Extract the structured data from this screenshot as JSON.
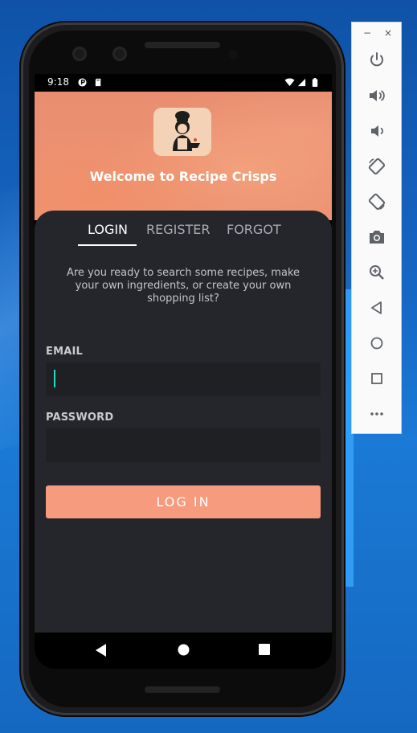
{
  "status_bar": {
    "time": "9:18"
  },
  "app": {
    "welcome_title": "Welcome to Recipe Crisps",
    "tabs": [
      {
        "label": "LOGIN",
        "active": true
      },
      {
        "label": "REGISTER",
        "active": false
      },
      {
        "label": "FORGOT",
        "active": false
      }
    ],
    "intro_text": "Are you ready to search some recipes, make your own ingredients, or create your own shopping list?",
    "email_label": "EMAIL",
    "email_value": "",
    "password_label": "PASSWORD",
    "password_value": "",
    "login_button_label": "LOG IN"
  },
  "colors": {
    "accent": "#f79b7e",
    "panel_bg": "#24262b",
    "field_bg": "#1e2024",
    "caret": "#2ad8c4"
  },
  "emulator_toolbar": {
    "window_controls": {
      "minimize": "−",
      "close": "×"
    },
    "buttons": [
      "power-icon",
      "volume-up-icon",
      "volume-down-icon",
      "rotate-left-icon",
      "rotate-right-icon",
      "camera-icon",
      "zoom-icon",
      "back-icon",
      "home-icon",
      "overview-icon",
      "more-icon"
    ]
  }
}
